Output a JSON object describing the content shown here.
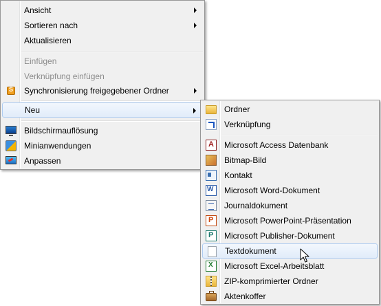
{
  "main_menu": {
    "ansicht": "Ansicht",
    "sortieren": "Sortieren nach",
    "aktualisieren": "Aktualisieren",
    "einfuegen": "Einfügen",
    "verknuepfung_einfuegen": "Verknüpfung einfügen",
    "synchronisierung": "Synchronisierung freigegebener Ordner",
    "neu": "Neu",
    "bildschirmaufloesung": "Bildschirmauflösung",
    "minianwendungen": "Minianwendungen",
    "anpassen": "Anpassen"
  },
  "sub_menu": {
    "ordner": "Ordner",
    "verknuepfung": "Verknüpfung",
    "access": "Microsoft Access Datenbank",
    "bitmap": "Bitmap-Bild",
    "kontakt": "Kontakt",
    "word": "Microsoft Word-Dokument",
    "journal": "Journaldokument",
    "powerpoint": "Microsoft PowerPoint-Präsentation",
    "publisher": "Microsoft Publisher-Dokument",
    "text": "Textdokument",
    "excel": "Microsoft Excel-Arbeitsblatt",
    "zip": "ZIP-komprimierter Ordner",
    "aktenkoffer": "Aktenkoffer"
  },
  "colors": {
    "menu_bg": "#f0f0f0",
    "menu_border": "#979797",
    "highlight_border": "#aeccf1",
    "disabled_text": "#8c8c8c"
  }
}
